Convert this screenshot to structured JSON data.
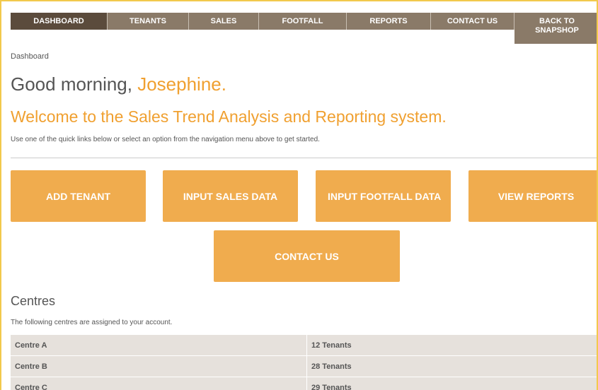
{
  "nav": {
    "items": [
      {
        "label": "DASHBOARD",
        "active": true
      },
      {
        "label": "TENANTS"
      },
      {
        "label": "SALES"
      },
      {
        "label": "FOOTFALL"
      },
      {
        "label": "REPORTS"
      },
      {
        "label": "CONTACT US"
      },
      {
        "label_line1": "BACK TO",
        "label_line2": "SNAPSHOP"
      }
    ]
  },
  "breadcrumb": "Dashboard",
  "greeting": {
    "prefix": "Good morning,",
    "name": "Josephine."
  },
  "welcome": "Welcome to the Sales Trend Analysis and Reporting system.",
  "intro": "Use one of the quick links below or select an option from the navigation menu above to get started.",
  "quick_links": [
    "ADD TENANT",
    "INPUT SALES DATA",
    "INPUT FOOTFALL DATA",
    "VIEW REPORTS",
    "CONTACT US"
  ],
  "centres": {
    "title": "Centres",
    "description": "The following centres are assigned to your account.",
    "rows": [
      {
        "name": "Centre A",
        "tenants": "12 Tenants"
      },
      {
        "name": "Centre B",
        "tenants": "28 Tenants"
      },
      {
        "name": "Centre C",
        "tenants": "29 Tenants"
      }
    ]
  },
  "colors": {
    "accent": "#f0a030",
    "button": "#f0ac4e",
    "nav": "#8a7a68",
    "nav_active": "#5b4b3c",
    "table_row": "#e6e1dc"
  }
}
